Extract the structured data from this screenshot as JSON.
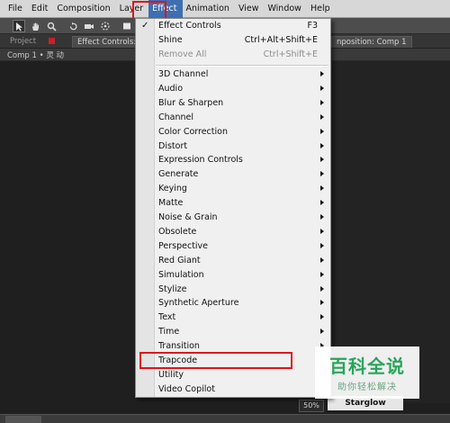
{
  "menubar": {
    "items": [
      "File",
      "Edit",
      "Composition",
      "Layer",
      "Effect",
      "Animation",
      "View",
      "Window",
      "Help"
    ]
  },
  "panels": {
    "project_tab": "Project",
    "effect_controls_tab": "Effect Controls: 灵",
    "composition_tab": "nposition: Comp 1",
    "breadcrumb": "Comp 1 • 灵 动"
  },
  "viewer": {
    "zoom": "50%",
    "effect_chip": "Starglow"
  },
  "effect_menu": {
    "top_items": [
      {
        "label": "Effect Controls",
        "shortcut": "F3",
        "checked": true,
        "enabled": true
      },
      {
        "label": "Shine",
        "shortcut": "Ctrl+Alt+Shift+E",
        "checked": false,
        "enabled": true
      },
      {
        "label": "Remove All",
        "shortcut": "Ctrl+Shift+E",
        "checked": false,
        "enabled": false
      }
    ],
    "categories": [
      {
        "label": "3D Channel"
      },
      {
        "label": "Audio"
      },
      {
        "label": "Blur & Sharpen"
      },
      {
        "label": "Channel"
      },
      {
        "label": "Color Correction"
      },
      {
        "label": "Distort"
      },
      {
        "label": "Expression Controls"
      },
      {
        "label": "Generate"
      },
      {
        "label": "Keying"
      },
      {
        "label": "Matte"
      },
      {
        "label": "Noise & Grain"
      },
      {
        "label": "Obsolete"
      },
      {
        "label": "Perspective"
      },
      {
        "label": "Red Giant"
      },
      {
        "label": "Simulation"
      },
      {
        "label": "Stylize"
      },
      {
        "label": "Synthetic Aperture"
      },
      {
        "label": "Text"
      },
      {
        "label": "Time"
      },
      {
        "label": "Transition"
      },
      {
        "label": "Trapcode"
      },
      {
        "label": "Utility"
      },
      {
        "label": "Video Copilot"
      }
    ],
    "highlighted": "Trapcode"
  },
  "watermark": {
    "title": "百科全说",
    "subtitle": "助你轻松解决"
  },
  "colors": {
    "menu_highlight": "#3e6fb1",
    "annotation_red": "#e0141a",
    "watermark_green": "#28a55a"
  }
}
